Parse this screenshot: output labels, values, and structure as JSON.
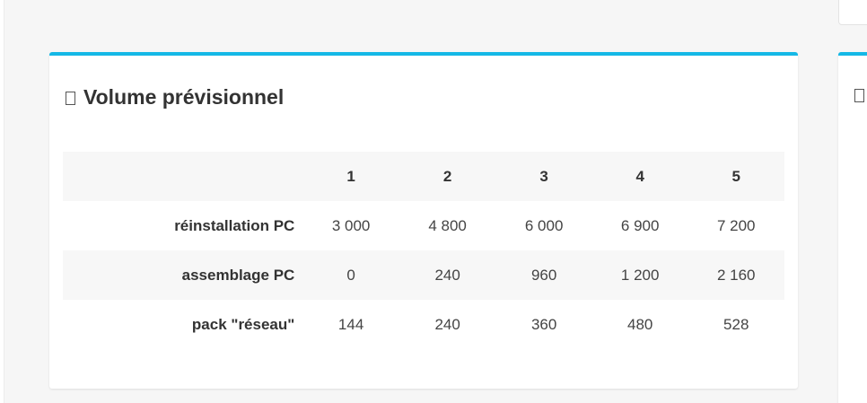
{
  "panel": {
    "icon": "calendar-icon",
    "title": "Volume prévisionnel",
    "accent_color": "#14b8e6"
  },
  "table": {
    "columns": [
      "1",
      "2",
      "3",
      "4",
      "5"
    ],
    "rows": [
      {
        "label": "réinstallation PC",
        "values": [
          "3 000",
          "4 800",
          "6 000",
          "6 900",
          "7 200"
        ]
      },
      {
        "label": "assemblage PC",
        "values": [
          "0",
          "240",
          "960",
          "1 200",
          "2 160"
        ]
      },
      {
        "label": "pack \"réseau\"",
        "values": [
          "144",
          "240",
          "360",
          "480",
          "528"
        ]
      }
    ]
  },
  "right_panel": {
    "icon": "calendar-icon"
  }
}
